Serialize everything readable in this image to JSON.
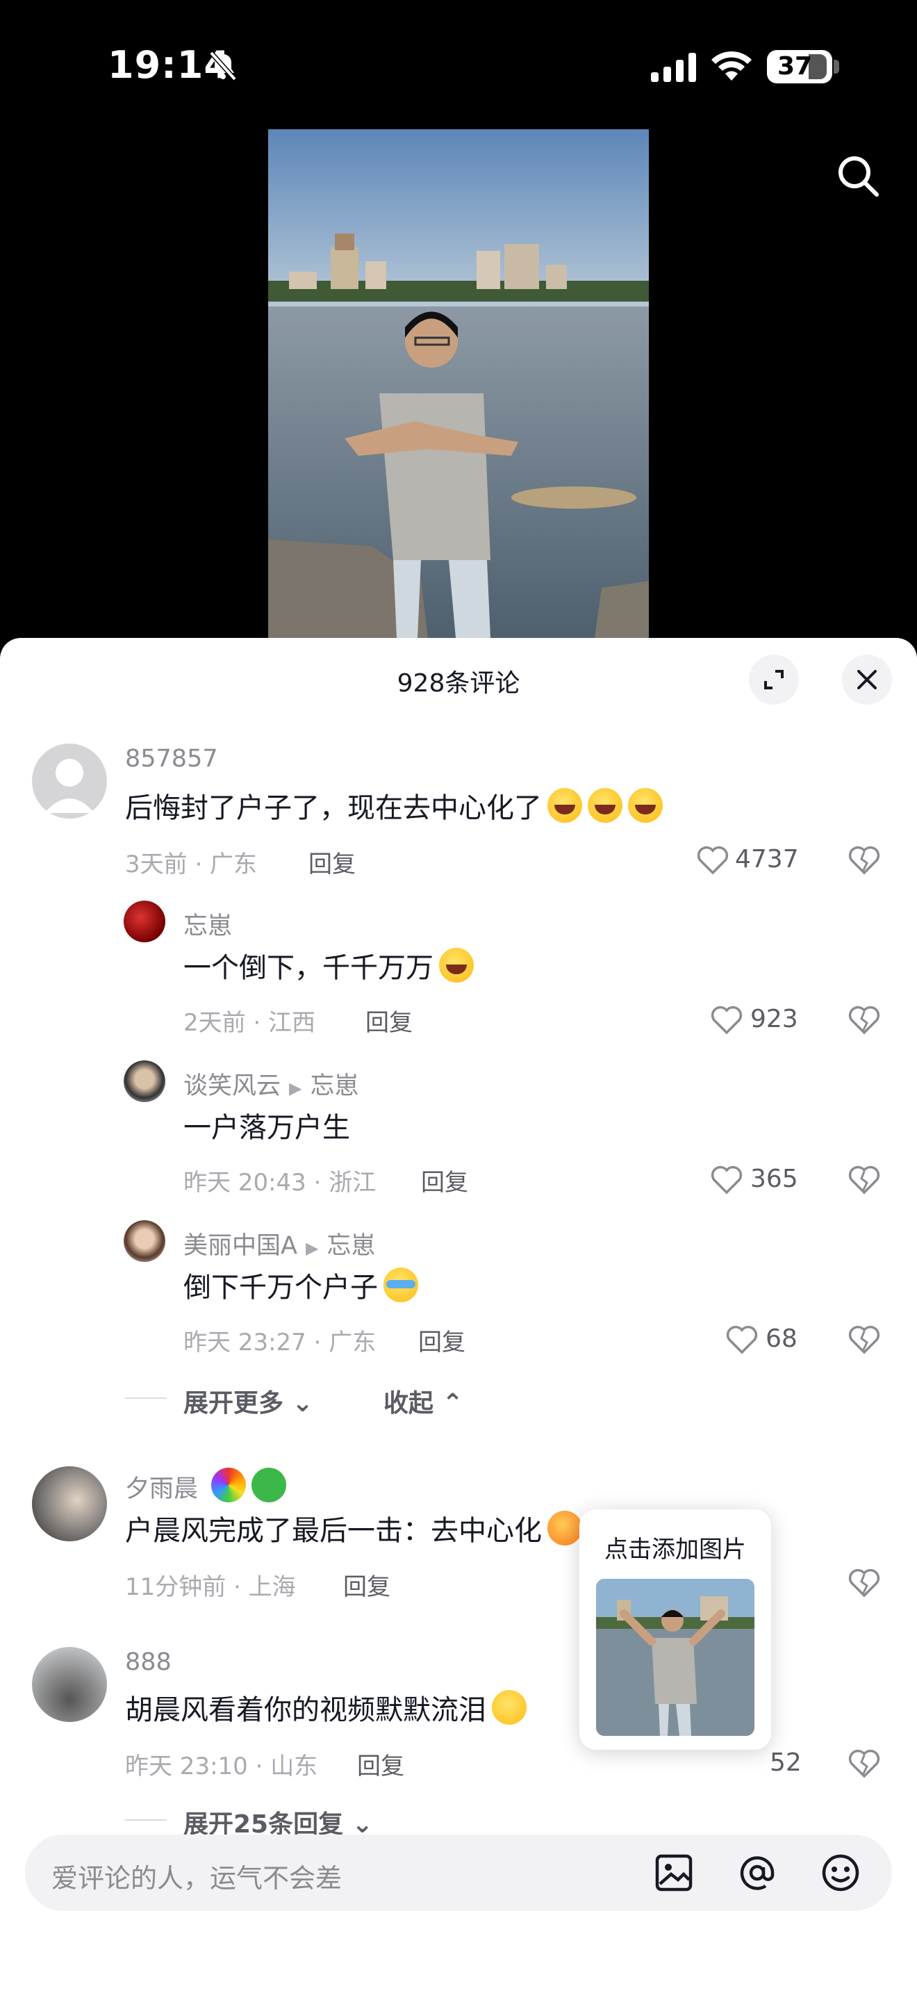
{
  "status_bar": {
    "time": "19:14",
    "battery": "37"
  },
  "sheet": {
    "title": "928条评论"
  },
  "comments": [
    {
      "username": "857857",
      "text": "后悔封了户子了，现在去中心化了",
      "meta": "3天前 · 广东",
      "reply_label": "回复",
      "likes": "4737",
      "replies": [
        {
          "username": "忘崽",
          "text": "一个倒下，千千万万",
          "meta": "2天前 · 江西",
          "reply_label": "回复",
          "likes": "923"
        },
        {
          "username": "谈笑风云",
          "reply_to": "忘崽",
          "text": "一户落万户生",
          "meta": "昨天 20:43 · 浙江",
          "reply_label": "回复",
          "likes": "365"
        },
        {
          "username": "美丽中国A",
          "reply_to": "忘崽",
          "text": "倒下千万个户子",
          "meta": "昨天 23:27 · 广东",
          "reply_label": "回复",
          "likes": "68"
        }
      ],
      "expand_more": "展开更多",
      "collapse": "收起"
    },
    {
      "username": "夕雨晨",
      "text": "户晨风完成了最后一击：去中心化",
      "meta": "11分钟前 · 上海",
      "reply_label": "回复"
    },
    {
      "username": "888",
      "text": "胡晨风看着你的视频默默流泪",
      "meta": "昨天 23:10 · 山东",
      "reply_label": "回复",
      "likes": "52",
      "expand_replies": "展开25条回复"
    }
  ],
  "tooltip": {
    "text": "点击添加图片"
  },
  "input": {
    "placeholder": "爱评论的人，运气不会差"
  },
  "icons": [
    "mute-icon",
    "signal-icon",
    "wifi-icon",
    "search-icon",
    "expand-icon",
    "close-icon",
    "heart-icon",
    "dislike-icon",
    "image-icon",
    "at-icon",
    "emoji-icon"
  ]
}
